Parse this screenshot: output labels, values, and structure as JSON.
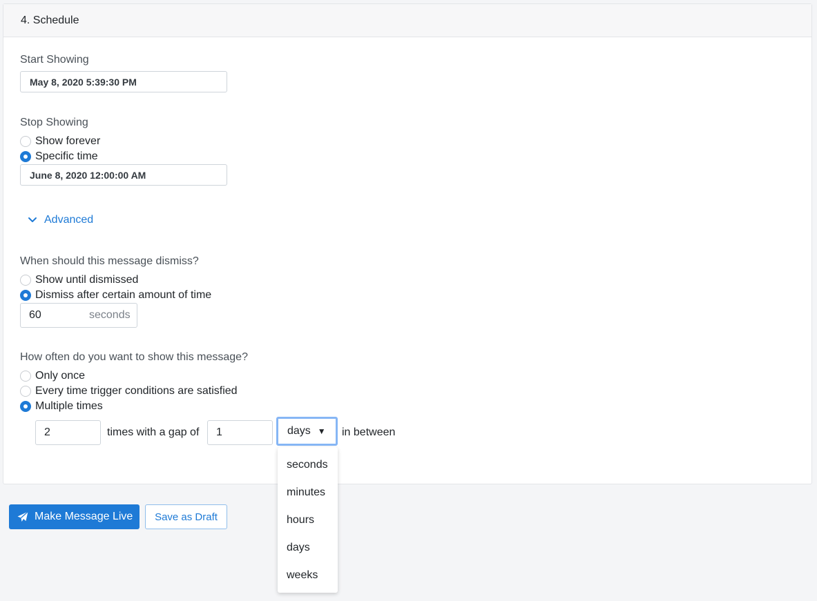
{
  "section": {
    "title": "4. Schedule"
  },
  "start": {
    "label": "Start Showing",
    "value": "May 8, 2020 5:39:30 PM"
  },
  "stop": {
    "label": "Stop Showing",
    "options": [
      "Show forever",
      "Specific time"
    ],
    "selected": "Specific time",
    "value": "June 8, 2020 12:00:00 AM"
  },
  "advanced": {
    "label": "Advanced"
  },
  "dismiss": {
    "question": "When should this message dismiss?",
    "options": [
      "Show until dismissed",
      "Dismiss after certain amount of time"
    ],
    "selected": "Dismiss after certain amount of time",
    "amount": "60",
    "unit": "seconds"
  },
  "frequency": {
    "question": "How often do you want to show this message?",
    "options": [
      "Only once",
      "Every time trigger conditions are satisfied",
      "Multiple times"
    ],
    "selected": "Multiple times",
    "times_value": "2",
    "text_gap": "times with a gap of",
    "gap_value": "1",
    "gap_unit": "days",
    "text_between": "in between",
    "unit_options": [
      "seconds",
      "minutes",
      "hours",
      "days",
      "weeks"
    ]
  },
  "actions": {
    "primary": "Make Message Live",
    "secondary": "Save as Draft"
  },
  "colors": {
    "accent": "#1e7ad6",
    "focus_ring": "#86b6f5",
    "page_background": "#f4f5f7"
  },
  "icons": {
    "advanced_toggle": "chevron-down-icon",
    "primary_button": "paper-plane-icon",
    "select_caret": "caret-down-icon"
  }
}
